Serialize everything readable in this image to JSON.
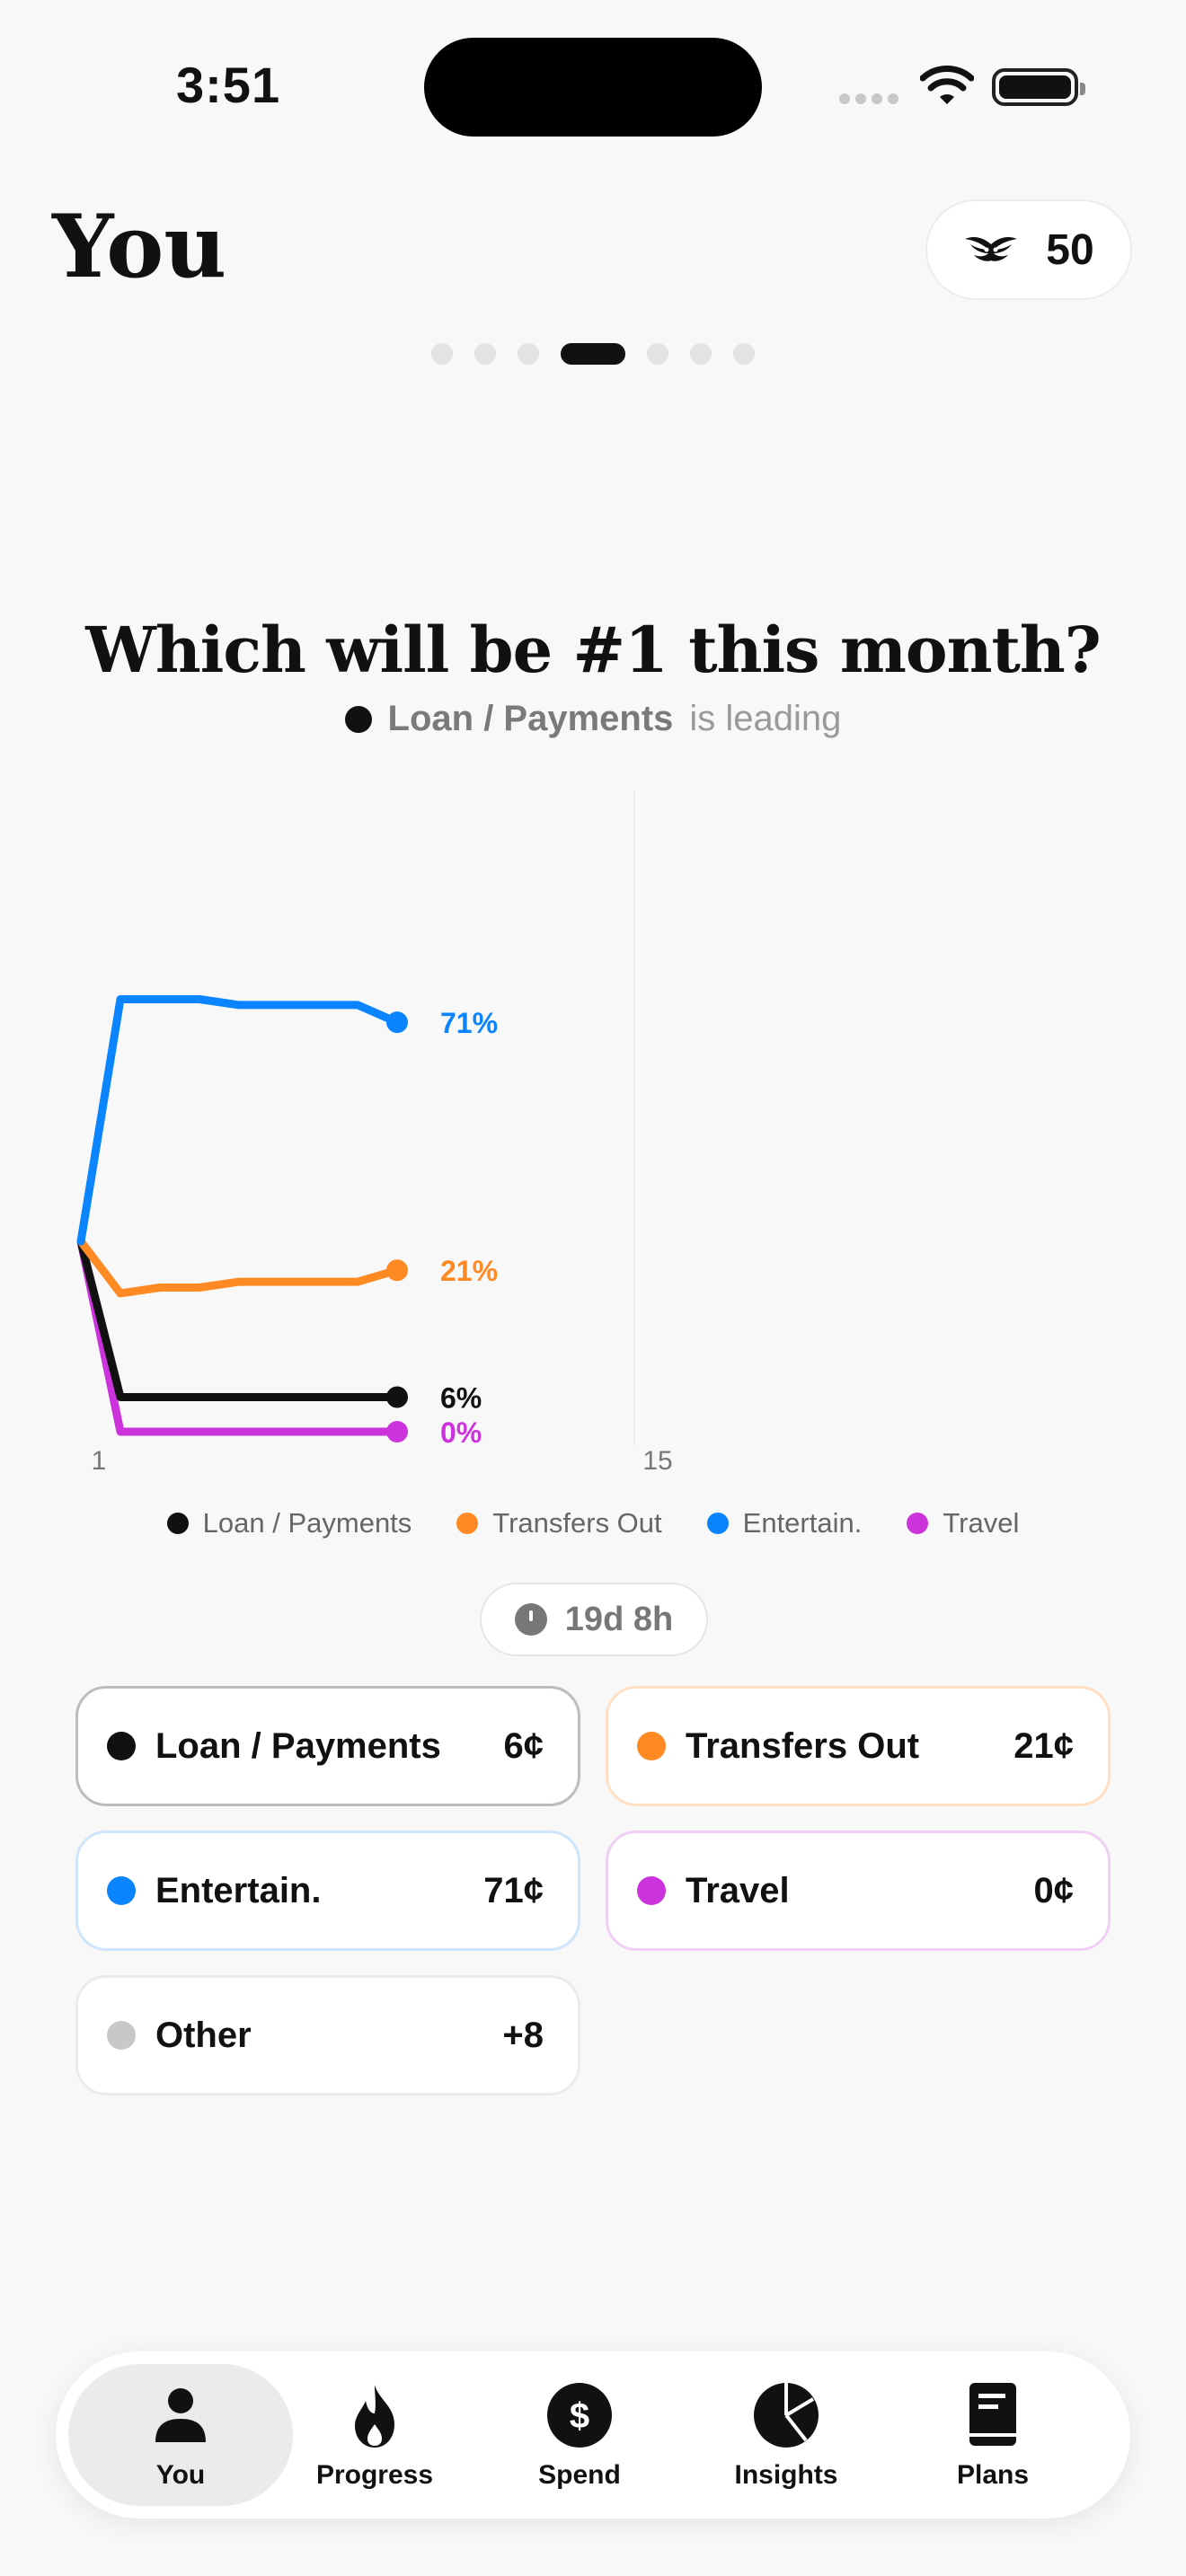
{
  "status_bar": {
    "time": "3:51"
  },
  "header": {
    "title": "You",
    "points": "50"
  },
  "pager": {
    "count": 7,
    "active_index": 3
  },
  "question": {
    "title": "Which will be #1 this month?",
    "leader_name": "Loan / Payments",
    "leader_suffix": "is leading"
  },
  "chart_data": {
    "type": "line",
    "x_ticks": [
      "1",
      "15"
    ],
    "xlim": [
      1,
      15
    ],
    "ylim": [
      0,
      100
    ],
    "series": [
      {
        "name": "Loan / Payments",
        "color": "#111111",
        "label": "6%",
        "x": [
          1,
          2,
          3,
          4,
          5,
          6,
          7,
          8,
          9
        ],
        "values": [
          33,
          6,
          6,
          6,
          6,
          6,
          6,
          6,
          6
        ]
      },
      {
        "name": "Transfers Out",
        "color": "#ff8a24",
        "label": "21%",
        "x": [
          1,
          2,
          3,
          4,
          5,
          6,
          7,
          8,
          9
        ],
        "values": [
          33,
          24,
          25,
          25,
          26,
          26,
          26,
          26,
          28
        ]
      },
      {
        "name": "Entertain.",
        "color": "#0a84ff",
        "label": "71%",
        "x": [
          1,
          2,
          3,
          4,
          5,
          6,
          7,
          8,
          9
        ],
        "values": [
          33,
          75,
          75,
          75,
          74,
          74,
          74,
          74,
          71
        ]
      },
      {
        "name": "Travel",
        "color": "#cc33dd",
        "label": "0%",
        "x": [
          1,
          2,
          3,
          4,
          5,
          6,
          7,
          8,
          9
        ],
        "values": [
          33,
          0,
          0,
          0,
          0,
          0,
          0,
          0,
          0
        ]
      }
    ]
  },
  "timer": {
    "label": "19d 8h"
  },
  "options": [
    {
      "label": "Loan / Payments",
      "amount": "6¢",
      "color": "#111111",
      "border": "#bdbdbd"
    },
    {
      "label": "Transfers Out",
      "amount": "21¢",
      "color": "#ff8a24",
      "border": "#ffe0c4"
    },
    {
      "label": "Entertain.",
      "amount": "71¢",
      "color": "#0a84ff",
      "border": "#cfe5fb"
    },
    {
      "label": "Travel",
      "amount": "0¢",
      "color": "#cc33dd",
      "border": "#f0cff4"
    },
    {
      "label": "Other",
      "amount": "+8",
      "color": "#c8c8c8",
      "border": "#ebebeb"
    }
  ],
  "tabs": [
    {
      "label": "You",
      "icon": "person-icon"
    },
    {
      "label": "Progress",
      "icon": "flame-icon"
    },
    {
      "label": "Spend",
      "icon": "dollar-icon"
    },
    {
      "label": "Insights",
      "icon": "pie-chart-icon"
    },
    {
      "label": "Plans",
      "icon": "book-icon"
    }
  ]
}
